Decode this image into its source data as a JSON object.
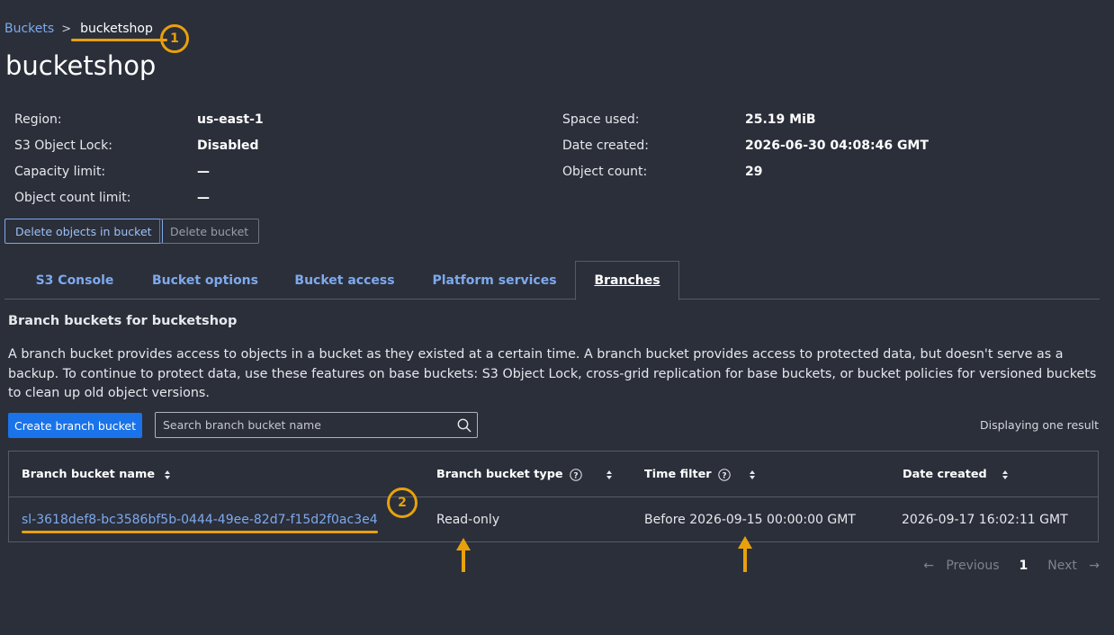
{
  "breadcrumb": {
    "root": "Buckets",
    "separator": ">",
    "current": "bucketshop"
  },
  "callouts": [
    "1",
    "2"
  ],
  "page_title": "bucketshop",
  "info_left": [
    {
      "label": "Region:",
      "value": "us-east-1"
    },
    {
      "label": "S3 Object Lock:",
      "value": "Disabled"
    },
    {
      "label": "Capacity limit:",
      "value": "—"
    },
    {
      "label": "Object count limit:",
      "value": "—"
    }
  ],
  "info_right": [
    {
      "label": "Space used:",
      "value": "25.19 MiB"
    },
    {
      "label": "Date created:",
      "value": "2026-06-30 04:08:46 GMT"
    },
    {
      "label": "Object count:",
      "value": "29"
    }
  ],
  "actions": {
    "delete_objects": "Delete objects in bucket",
    "delete_bucket": "Delete bucket"
  },
  "tabs": [
    {
      "label": "S3 Console",
      "active": false
    },
    {
      "label": "Bucket options",
      "active": false
    },
    {
      "label": "Bucket access",
      "active": false
    },
    {
      "label": "Platform services",
      "active": false
    },
    {
      "label": "Branches",
      "active": true
    }
  ],
  "branches": {
    "title": "Branch buckets for bucketshop",
    "description": "A branch bucket provides access to objects in a bucket as they existed at a certain time. A branch bucket provides access to protected data, but doesn't serve as a backup. To continue to protect data, use these features on base buckets: S3 Object Lock, cross-grid replication for base buckets, or bucket policies for versioned buckets to clean up old object versions.",
    "create_button": "Create branch bucket",
    "search_placeholder": "Search branch bucket name",
    "result_count": "Displaying one result",
    "columns": [
      "Branch bucket name",
      "Branch bucket type",
      "Time filter",
      "Date created"
    ],
    "rows": [
      {
        "name": "sl-3618def8-bc3586bf5b-0444-49ee-82d7-f15d2f0ac3e4",
        "type": "Read-only",
        "time_filter": "Before 2026-09-15 00:00:00 GMT",
        "date_created": "2026-09-17 16:02:11 GMT"
      }
    ]
  },
  "pagination": {
    "previous": "Previous",
    "page": "1",
    "next": "Next",
    "prev_arrow": "←",
    "next_arrow": "→"
  },
  "colors": {
    "background": "#2b2f3a",
    "link": "#7ea9ec",
    "primary": "#1a73e8",
    "annotation": "#e8a10c"
  }
}
